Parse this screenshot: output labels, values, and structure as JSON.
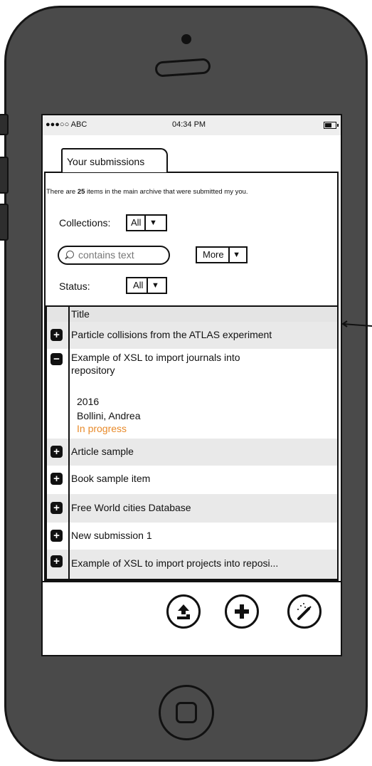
{
  "status_bar": {
    "carrier": "●●●○○ ABC",
    "time": "04:34 PM"
  },
  "tab": {
    "label": "Your submissions"
  },
  "info": {
    "pre": "There are ",
    "count": "25",
    "post": " items in the main archive that were submitted my you."
  },
  "filters": {
    "collections_label": "Collections:",
    "collections_value": "All",
    "search_placeholder": "contains text",
    "more_label": "More",
    "status_label": "Status:",
    "status_value": "All"
  },
  "table": {
    "header": "Title",
    "rows": [
      {
        "title": "Particle collisions from the ATLAS experiment",
        "toggle": "+"
      },
      {
        "title_line1": "Example of XSL to import journals into",
        "title_line2": "repository",
        "toggle": "−",
        "year": "2016",
        "author": "Bollini, Andrea",
        "status": "In progress"
      },
      {
        "title": "Article sample",
        "toggle": "+"
      },
      {
        "title": "Book sample item",
        "toggle": "+"
      },
      {
        "title": "Free World cities Database",
        "toggle": "+"
      },
      {
        "title": "New submission 1",
        "toggle": "+"
      },
      {
        "title": "Example of XSL to import projects into reposi...",
        "toggle": "+"
      }
    ]
  },
  "actions": {
    "upload_icon": "upload-icon",
    "add_icon": "plus-icon",
    "magic_icon": "magic-wand-icon"
  },
  "colors": {
    "status_in_progress": "#e88a2a",
    "phone_body": "#4a4a4a"
  }
}
